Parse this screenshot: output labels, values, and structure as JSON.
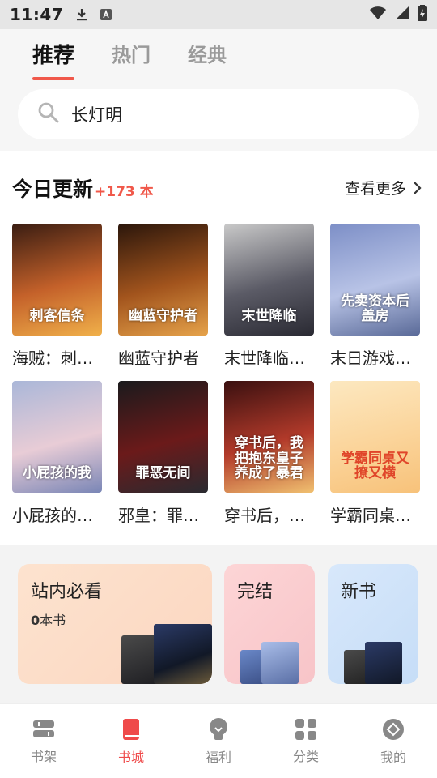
{
  "status": {
    "time": "11:47"
  },
  "tabs": [
    {
      "label": "推荐"
    },
    {
      "label": "热门"
    },
    {
      "label": "经典"
    }
  ],
  "search": {
    "value": "长灯明"
  },
  "update": {
    "title": "今日更新",
    "count": "+173 本",
    "more": "查看更多"
  },
  "books": [
    {
      "title": "海贼：刺…",
      "cover_text": "刺客信条",
      "colors": [
        "#3a1d12",
        "#c4612a",
        "#f0b04a"
      ]
    },
    {
      "title": "幽蓝守护者",
      "cover_text": "幽蓝守护者",
      "colors": [
        "#2b160b",
        "#a2541d",
        "#e5a24a"
      ]
    },
    {
      "title": "末世降临…",
      "cover_text": "末世降临",
      "colors": [
        "#c9c9c9",
        "#5b5b66",
        "#2a2a33"
      ]
    },
    {
      "title": "末日游戏…",
      "cover_text": "先卖资本后盖房",
      "colors": [
        "#7d8fc7",
        "#b8c3e6",
        "#5a6a98"
      ]
    },
    {
      "title": "小屁孩的…",
      "cover_text": "小屁孩的我",
      "colors": [
        "#aab7d8",
        "#e8ccd6",
        "#7a86b6"
      ]
    },
    {
      "title": "邪皇：罪…",
      "cover_text": "罪恶无间",
      "colors": [
        "#1a1a1c",
        "#6b1a1a",
        "#2a2a30"
      ]
    },
    {
      "title": "穿书后，…",
      "cover_text": "穿书后，我把抱东皇子养成了暴君",
      "colors": [
        "#3a1010",
        "#b23a2a",
        "#f0c070"
      ]
    },
    {
      "title": "学霸同桌…",
      "cover_text": "学霸同桌又撩又横",
      "colors": [
        "#fce8c0",
        "#fbd49a",
        "#f7c27a"
      ]
    }
  ],
  "categories": {
    "must": {
      "label": "站内必看",
      "count": "0",
      "unit": "本书"
    },
    "done": {
      "label": "完结"
    },
    "new": {
      "label": "新书"
    }
  },
  "nav": [
    {
      "label": "书架",
      "icon": "bookshelf-icon"
    },
    {
      "label": "书城",
      "icon": "bookstore-icon"
    },
    {
      "label": "福利",
      "icon": "bulb-icon"
    },
    {
      "label": "分类",
      "icon": "grid-icon"
    },
    {
      "label": "我的",
      "icon": "profile-icon"
    }
  ],
  "colors": {
    "accent": "#f0584a",
    "nav_active": "#ef4a4a"
  }
}
